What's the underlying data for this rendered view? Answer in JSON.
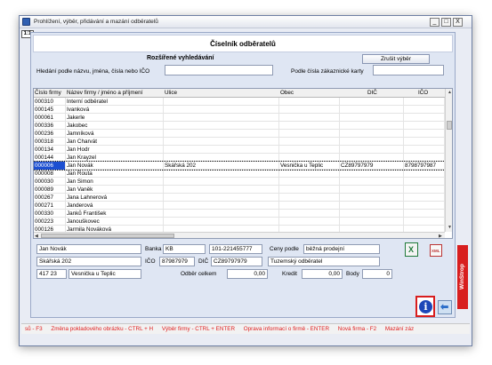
{
  "window": {
    "title": "Prohlížení, výběr, přidávání a mazání odběratelů",
    "ratio_badge": "1:1",
    "minimize_label": "_",
    "maximize_label": "□",
    "close_label": "X"
  },
  "header": {
    "title": "Číselník odběratelů"
  },
  "search": {
    "heading": "Rozšířené vyhledávání",
    "clear_button": "Zrušit výběr",
    "name_label": "Hledání podle názvu, jména, čísla nebo IČO",
    "card_label": "Podle čísla zákaznické karty",
    "name_value": "",
    "card_value": ""
  },
  "grid": {
    "columns": [
      "Číslo firmy",
      "Název firmy / jméno a příjmení",
      "Ulice",
      "Obec",
      "DIČ",
      "IČO"
    ],
    "rows": [
      [
        "000310",
        "Interní odběratel",
        "",
        "",
        "",
        ""
      ],
      [
        "000145",
        "Ivanková",
        "",
        "",
        "",
        ""
      ],
      [
        "000061",
        "Jakerle",
        "",
        "",
        "",
        ""
      ],
      [
        "000336",
        "Jakobec",
        "",
        "",
        "",
        ""
      ],
      [
        "000236",
        "Jamníková",
        "",
        "",
        "",
        ""
      ],
      [
        "000318",
        "Jan Charvát",
        "",
        "",
        "",
        ""
      ],
      [
        "000134",
        "Jan Hodr",
        "",
        "",
        "",
        ""
      ],
      [
        "000144",
        "Jan Krayzel",
        "",
        "",
        "",
        ""
      ],
      [
        "000006",
        "Jan Novák",
        "Skářská 202",
        "Vesnička u Teplic",
        "CZ89797979",
        "8798797987"
      ],
      [
        "000008",
        "Jan Routa",
        "",
        "",
        "",
        ""
      ],
      [
        "000030",
        "Jan Simon",
        "",
        "",
        "",
        ""
      ],
      [
        "000089",
        "Jan Vaněk",
        "",
        "",
        "",
        ""
      ],
      [
        "000267",
        "Jana Lahnerová",
        "",
        "",
        "",
        ""
      ],
      [
        "000271",
        "Janderová",
        "",
        "",
        "",
        ""
      ],
      [
        "000330",
        "Janků František",
        "",
        "",
        "",
        ""
      ],
      [
        "000223",
        "Janouškovec",
        "",
        "",
        "",
        ""
      ],
      [
        "000126",
        "Jarmila Nováková",
        "",
        "",
        "",
        ""
      ]
    ],
    "selected_index": 8
  },
  "detail": {
    "name": "Jan Novák",
    "bank_label": "Banka",
    "bank": "KB",
    "account": "101-221455777",
    "price_label": "Ceny podle",
    "price_value": "běžná prodejní",
    "street": "Skářská 202",
    "ico_label": "IČO",
    "ico": "87987979",
    "dic_label": "DIČ",
    "dic": "CZ89797979",
    "customer_type": "Tuzemský odběratel",
    "zip": "417 23",
    "city": "Vesnička u Teplic",
    "turnover_label": "Odběr celkem",
    "turnover": "0,00",
    "credit_label": "Kredit",
    "credit": "0,00",
    "points_label": "Body",
    "points": "0"
  },
  "icons": {
    "xml_label": "XML",
    "info_label": "i",
    "back_label": "⬅"
  },
  "brand": {
    "vertical_label": "WinStrop"
  },
  "status_bar": {
    "items": [
      "sů - F3",
      "Změna pokladového obrázku - CTRL + H",
      "Výběr firmy - CTRL + ENTER",
      "Oprava informací o firmě - ENTER",
      "Nová firma - F2",
      "Mazání záz"
    ]
  },
  "colors": {
    "selection": "#1c4fd1",
    "status_text": "#e02020",
    "brand_red": "#d81e1e"
  }
}
